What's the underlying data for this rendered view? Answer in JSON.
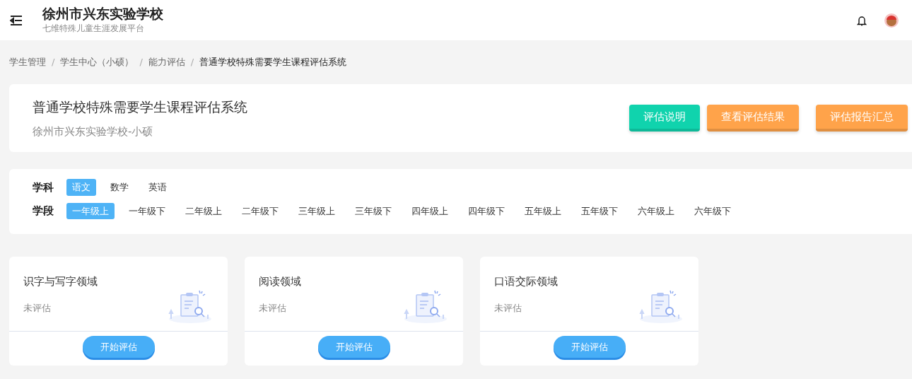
{
  "header": {
    "title": "徐州市兴东实验学校",
    "subtitle": "七维特殊儿童生涯发展平台"
  },
  "breadcrumb": [
    {
      "label": "学生管理",
      "current": false
    },
    {
      "separator": "/",
      "label": "学生中心（小硕）",
      "current": false
    },
    {
      "separator": "/",
      "label": "能力评估",
      "current": false
    },
    {
      "separator": "/",
      "label": "普通学校特殊需要学生课程评估系统",
      "current": true
    }
  ],
  "summary": {
    "title": "普通学校特殊需要学生课程评估系统",
    "subtitle": "徐州市兴东实验学校-小硕",
    "buttons": [
      {
        "label": "评估说明",
        "color": "#10d3ad"
      },
      {
        "label": "查看评估结果",
        "color": "#ffa34a"
      },
      {
        "label": "评估报告汇总",
        "color": "#ffa34a"
      }
    ]
  },
  "filters": [
    {
      "label": "学科",
      "options": [
        {
          "label": "语文",
          "selected": true
        },
        {
          "label": "数学",
          "selected": false
        },
        {
          "label": "英语",
          "selected": false
        }
      ]
    },
    {
      "label": "学段",
      "options": [
        {
          "label": "一年级上",
          "selected": true
        },
        {
          "label": "一年级下",
          "selected": false
        },
        {
          "label": "二年级上",
          "selected": false
        },
        {
          "label": "二年级下",
          "selected": false
        },
        {
          "label": "三年级上",
          "selected": false
        },
        {
          "label": "三年级下",
          "selected": false
        },
        {
          "label": "四年级上",
          "selected": false
        },
        {
          "label": "四年级下",
          "selected": false
        },
        {
          "label": "五年级上",
          "selected": false
        },
        {
          "label": "五年级下",
          "selected": false
        },
        {
          "label": "六年级上",
          "selected": false
        },
        {
          "label": "六年级下",
          "selected": false
        }
      ]
    }
  ],
  "domains": [
    {
      "title": "识字与写字领域",
      "status": "未评估",
      "button": "开始评估"
    },
    {
      "title": "阅读领域",
      "status": "未评估",
      "button": "开始评估"
    },
    {
      "title": "口语交际领域",
      "status": "未评估",
      "button": "开始评估"
    }
  ]
}
